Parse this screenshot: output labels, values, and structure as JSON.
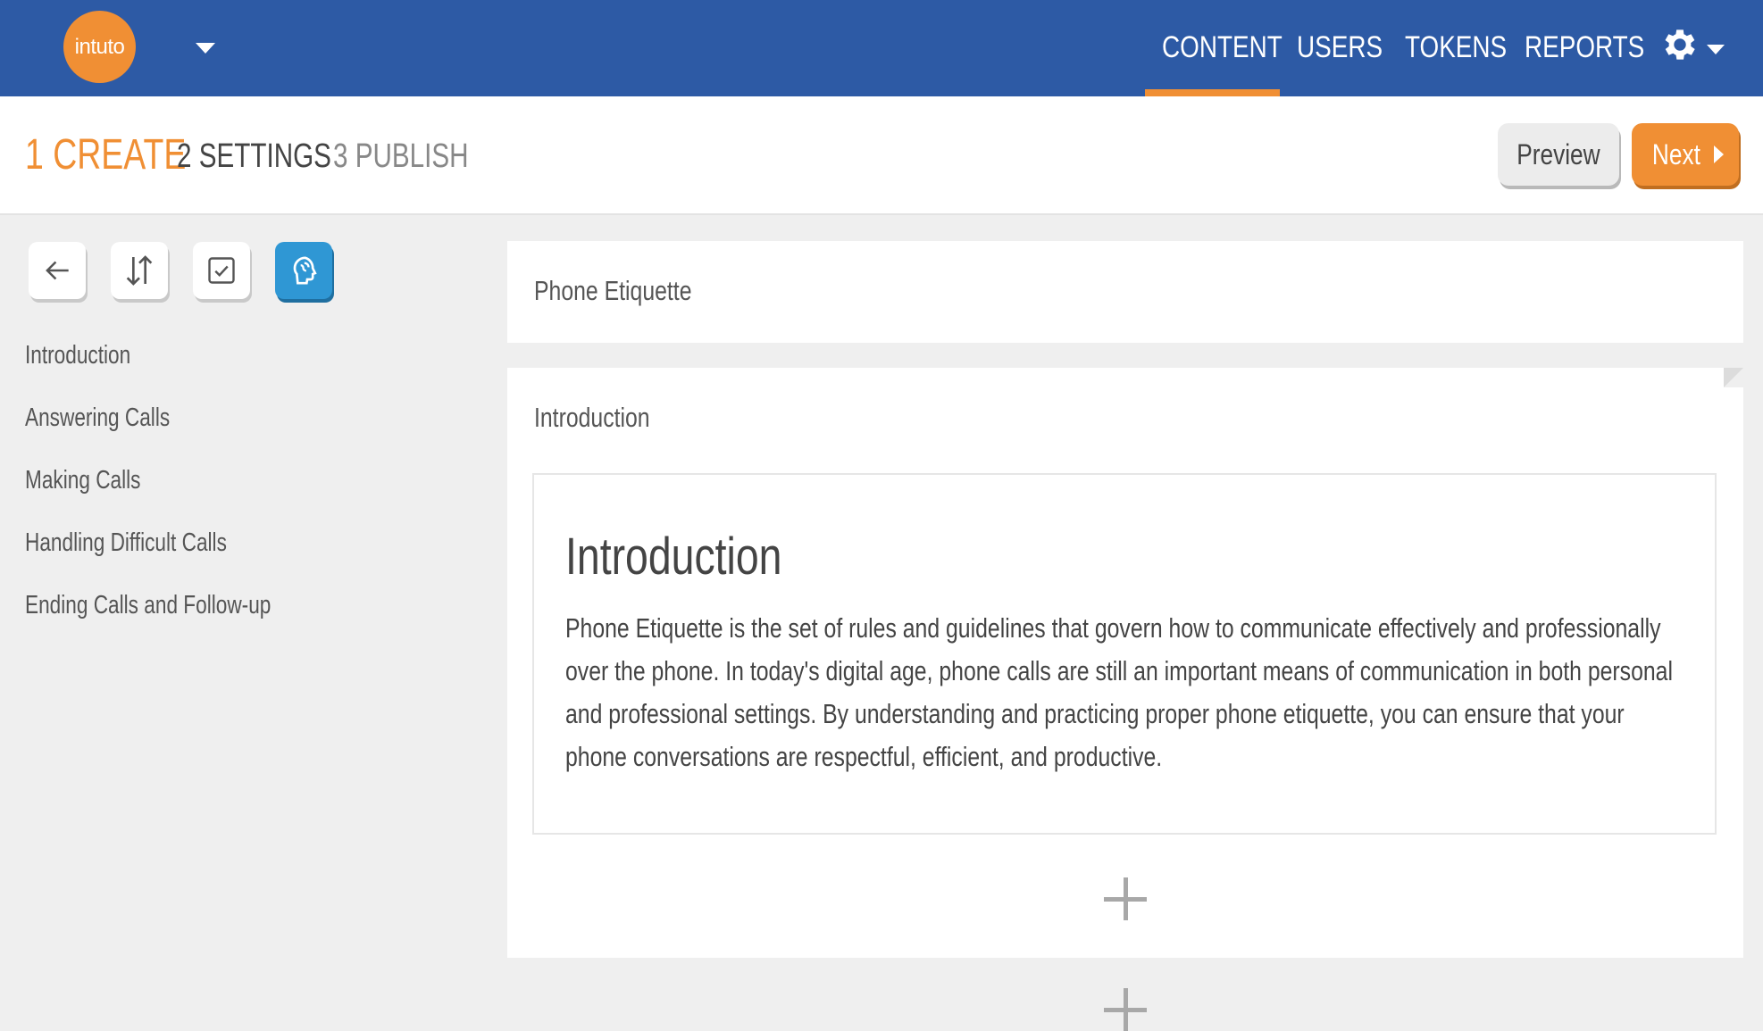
{
  "brand": {
    "logo_text": "intuto"
  },
  "nav": {
    "items": [
      {
        "label": "CONTENT",
        "active": true
      },
      {
        "label": "USERS",
        "active": false
      },
      {
        "label": "TOKENS",
        "active": false
      },
      {
        "label": "REPORTS",
        "active": false
      }
    ]
  },
  "steps": {
    "create": "1 CREATE",
    "settings": "2 SETTINGS",
    "publish": "3 PUBLISH"
  },
  "actions": {
    "preview_label": "Preview",
    "next_label": "Next"
  },
  "toolbar": {
    "icons": [
      "back-arrow-icon",
      "reorder-icon",
      "checkbox-icon",
      "brain-icon"
    ]
  },
  "outline": {
    "items": [
      "Introduction",
      "Answering Calls",
      "Making Calls",
      "Handling Difficult Calls",
      "Ending Calls and Follow-up"
    ]
  },
  "course": {
    "title": "Phone Etiquette"
  },
  "section": {
    "label": "Introduction",
    "heading": "Introduction",
    "body": "Phone Etiquette is the set of rules and guidelines that govern how to communicate effectively and professionally over the phone. In today's digital age, phone calls are still an important means of communication in both personal and professional settings. By understanding and practicing proper phone etiquette, you can ensure that your phone conversations are respectful, efficient, and productive."
  },
  "colors": {
    "header_bg": "#2d5aa5",
    "accent": "#f08f34",
    "active_tool": "#2f97d4",
    "page_bg": "#efefef"
  }
}
